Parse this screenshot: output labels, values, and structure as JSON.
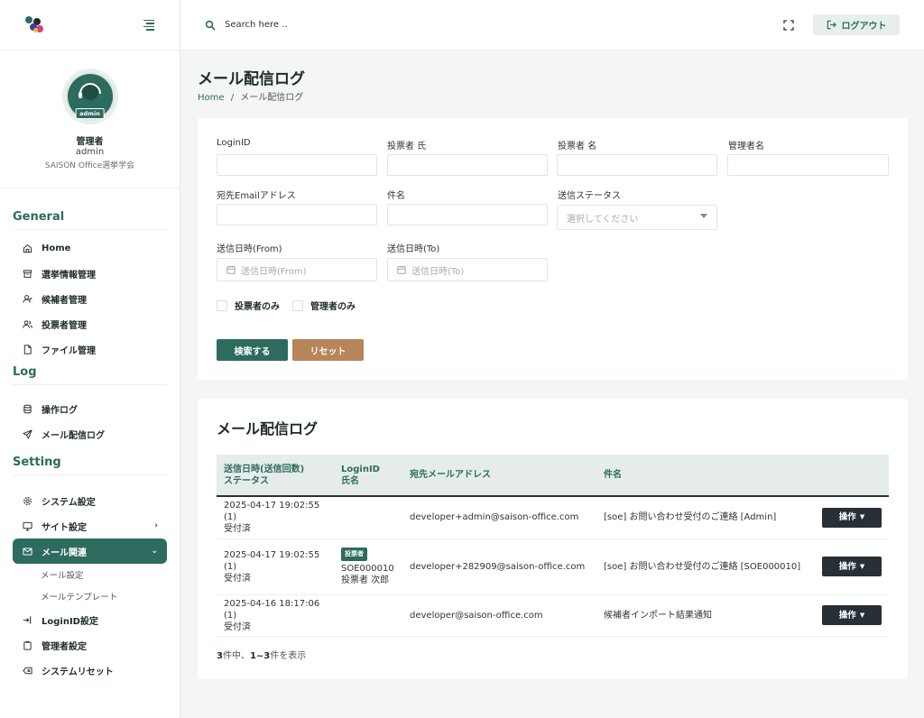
{
  "sidebar": {
    "profile": {
      "badge": "admin",
      "name": "管理者",
      "id": "admin",
      "org": "SAISON Office選挙学会"
    },
    "sections": [
      {
        "title": "General",
        "items": [
          {
            "label": "Home",
            "icon": "home-icon"
          },
          {
            "label": "選挙情報管理",
            "icon": "archive-icon"
          },
          {
            "label": "候補者管理",
            "icon": "user-check-icon"
          },
          {
            "label": "投票者管理",
            "icon": "users-icon"
          },
          {
            "label": "ファイル管理",
            "icon": "file-icon"
          }
        ]
      },
      {
        "title": "Log",
        "items": [
          {
            "label": "操作ログ",
            "icon": "database-icon"
          },
          {
            "label": "メール配信ログ",
            "icon": "send-icon"
          }
        ]
      },
      {
        "title": "Setting",
        "items": [
          {
            "label": "システム設定",
            "icon": "gear-icon"
          },
          {
            "label": "サイト設定",
            "icon": "monitor-icon"
          },
          {
            "label": "メール関連",
            "icon": "mail-icon"
          },
          {
            "label": "メール設定"
          },
          {
            "label": "メールテンプレート"
          },
          {
            "label": "LoginID設定",
            "icon": "login-icon"
          },
          {
            "label": "管理者設定",
            "icon": "clipboard-icon"
          },
          {
            "label": "システムリセット",
            "icon": "delete-icon"
          }
        ]
      }
    ]
  },
  "topbar": {
    "search_placeholder": "Search here ..",
    "logout_label": "ログアウト"
  },
  "page": {
    "title": "メール配信ログ",
    "breadcrumb_home": "Home",
    "breadcrumb_sep": "/",
    "breadcrumb_current": "メール配信ログ"
  },
  "filters": {
    "login_id_label": "LoginID",
    "voter_last_label": "投票者 氏",
    "voter_first_label": "投票者 名",
    "admin_name_label": "管理者名",
    "email_label": "宛先Emailアドレス",
    "subject_label": "件名",
    "status_label": "送信ステータス",
    "status_placeholder": "選択してください",
    "date_from_label": "送信日時(From)",
    "date_from_placeholder": "送信日時(From)",
    "date_to_label": "送信日時(To)",
    "date_to_placeholder": "送信日時(To)",
    "voters_only_label": "投票者のみ",
    "admins_only_label": "管理者のみ",
    "search_button": "検索する",
    "reset_button": "リセット"
  },
  "log_table": {
    "title": "メール配信ログ",
    "headers": {
      "col1_line1": "送信日時(送信回数)",
      "col1_line2": "ステータス",
      "col2_line1": "LoginID",
      "col2_line2": "氏名",
      "col3": "宛先メールアドレス",
      "col4": "件名"
    },
    "rows": [
      {
        "sent_at": "2025-04-17 19:02:55 (1)",
        "status": "受付済",
        "badge": "",
        "login_id": "",
        "name": "",
        "email": "developer+admin@saison-office.com",
        "subject": "[soe] お問い合わせ受付のご連絡 [Admin]",
        "action": "操作"
      },
      {
        "sent_at": "2025-04-17 19:02:55 (1)",
        "status": "受付済",
        "badge": "投票者",
        "login_id": "SOE000010",
        "name": "投票者 次郎",
        "email": "developer+282909@saison-office.com",
        "subject": "[soe] お問い合わせ受付のご連絡 [SOE000010]",
        "action": "操作"
      },
      {
        "sent_at": "2025-04-16 18:17:06 (1)",
        "status": "受付済",
        "badge": "",
        "login_id": "",
        "name": "",
        "email": "developer@saison-office.com",
        "subject": "候補者インポート結果通知",
        "action": "操作"
      }
    ],
    "pager": {
      "total": "3",
      "total_suffix": "件中、",
      "range": "1~3",
      "range_suffix": "件を表示"
    }
  },
  "colors": {
    "primary": "#2d6b5e",
    "reset": "#b8855a",
    "dark": "#273036"
  }
}
